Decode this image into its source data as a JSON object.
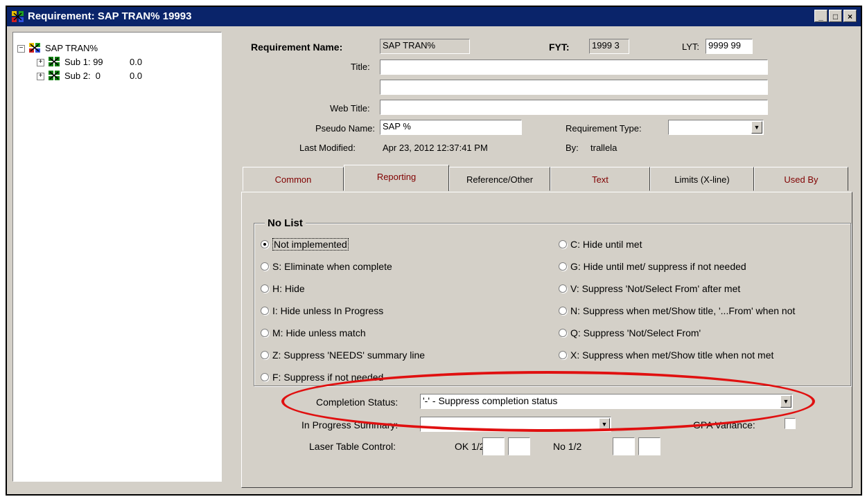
{
  "window": {
    "title": "Requirement: SAP TRAN% 19993",
    "buttons": {
      "minimize": "_",
      "maximize": "□",
      "close": "×"
    }
  },
  "tree": {
    "root": {
      "label": "SAP TRAN%",
      "expander": "−"
    },
    "children": [
      {
        "label": "Sub 1: 99",
        "value": "0.0",
        "expander": "+"
      },
      {
        "label": "Sub 2:  0",
        "value": "0.0",
        "expander": "+"
      }
    ]
  },
  "header": {
    "req_name_label": "Requirement Name:",
    "req_name_value": "SAP TRAN%",
    "fyt_label": "FYT:",
    "fyt_value": "1999 3",
    "lyt_label": "LYT:",
    "lyt_value": "9999 99",
    "title_label": "Title:",
    "title_value1": "",
    "title_value2": "",
    "web_title_label": "Web Title:",
    "web_title_value": "",
    "pseudo_label": "Pseudo Name:",
    "pseudo_value": "SAP %",
    "req_type_label": "Requirement Type:",
    "req_type_value": "",
    "last_modified_label": "Last Modified:",
    "last_modified_value": "Apr 23, 2012  12:37:41 PM",
    "by_label": "By:",
    "by_value": "trallela"
  },
  "tabs": [
    {
      "label": "Common"
    },
    {
      "label": "Reporting"
    },
    {
      "label": "Reference/Other"
    },
    {
      "label": "Text"
    },
    {
      "label": "Limits (X-line)"
    },
    {
      "label": "Used By"
    }
  ],
  "reporting": {
    "group_title": "No List",
    "left_options": [
      "Not implemented",
      "S: Eliminate when complete",
      "H: Hide",
      "I: Hide unless In Progress",
      "M: Hide unless match",
      "Z: Suppress 'NEEDS' summary line",
      "F: Suppress if not needed"
    ],
    "right_options": [
      "C: Hide until met",
      "G: Hide until met/ suppress if not needed",
      "V: Suppress 'Not/Select From' after met",
      "N: Suppress when met/Show title, '...From' when not",
      "Q: Suppress 'Not/Select From'",
      "X: Suppress when met/Show title when not met"
    ],
    "selected": "Not implemented",
    "completion_status_label": "Completion Status:",
    "completion_status_value": "'-' - Suppress completion status",
    "in_progress_label": "In Progress Summary:",
    "in_progress_value": "",
    "gpa_label": "GPA Variance:",
    "laser_label": "Laser Table Control:",
    "ok_label": "OK 1/2",
    "no_label": "No 1/2"
  }
}
